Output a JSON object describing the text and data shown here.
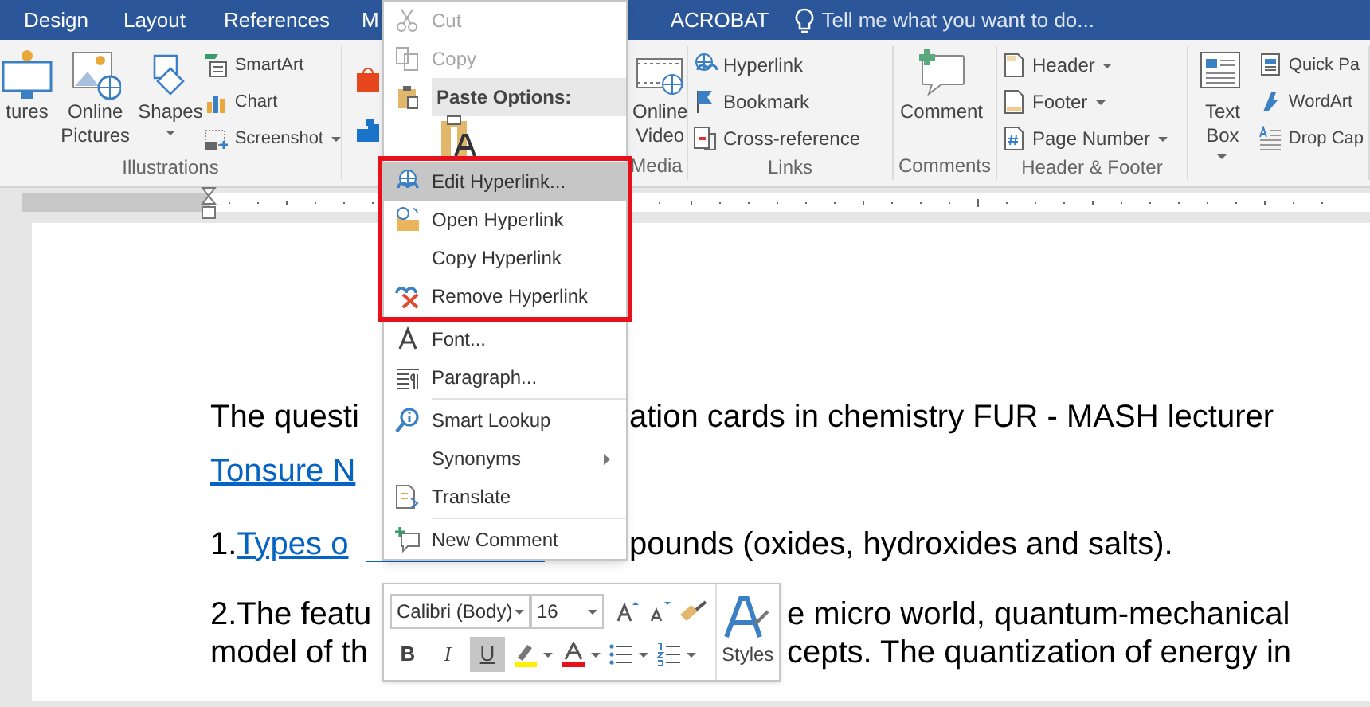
{
  "tabs": [
    {
      "label": "Design"
    },
    {
      "label": "Layout"
    },
    {
      "label": "References"
    },
    {
      "label": "M"
    },
    {
      "label": "ACROBAT"
    }
  ],
  "tell_me": {
    "placeholder": "Tell me what you want to do..."
  },
  "ribbon_groups": [
    {
      "kind": "group",
      "label": "Illustrations",
      "items": [
        {
          "kind": "large",
          "label": "tures"
        },
        {
          "kind": "large",
          "label": "Online Pictures"
        },
        {
          "kind": "large",
          "label": "Shapes",
          "dropdown": true
        },
        {
          "kind": "stack",
          "items": [
            {
              "label": "SmartArt"
            },
            {
              "label": "Chart"
            },
            {
              "label": "Screenshot",
              "dropdown": true
            }
          ]
        }
      ]
    },
    {
      "kind": "icon_group"
    },
    {
      "kind": "group",
      "label": "Media",
      "items": [
        {
          "kind": "large",
          "label": "Online Video"
        }
      ]
    },
    {
      "kind": "group",
      "label": "Links",
      "items": [
        {
          "kind": "stack",
          "items": [
            {
              "label": "Hyperlink"
            },
            {
              "label": "Bookmark"
            },
            {
              "label": "Cross-reference"
            }
          ]
        }
      ]
    },
    {
      "kind": "group",
      "label": "Comments",
      "items": [
        {
          "kind": "large",
          "label": "Comment"
        }
      ]
    },
    {
      "kind": "group",
      "label": "Header & Footer",
      "items": [
        {
          "kind": "stack",
          "items": [
            {
              "label": "Header",
              "dropdown": true
            },
            {
              "label": "Footer",
              "dropdown": true
            },
            {
              "label": "Page Number",
              "dropdown": true
            }
          ]
        }
      ]
    },
    {
      "kind": "group",
      "items": [
        {
          "kind": "large",
          "label": "Text Box",
          "dropdown": true
        },
        {
          "kind": "stack",
          "items": [
            {
              "label": "Quick Pa"
            },
            {
              "label": "WordArt"
            },
            {
              "label": "Drop Cap"
            }
          ]
        }
      ]
    }
  ],
  "document": {
    "lines": [
      {
        "left": [
          {
            "text": "The questi",
            "link": false
          }
        ],
        "right": [
          {
            "text": "ation cards in chemistry FUR - MASH lecturer",
            "link": false
          }
        ]
      },
      {
        "left": [
          {
            "text": "Tonsure N",
            "link": true
          }
        ]
      },
      {
        "left": [
          {
            "text": "1. ",
            "link": false
          },
          {
            "text": "Types o",
            "link": true
          }
        ],
        "right": [
          {
            "text": "pounds (oxides, hydroxides and salts).",
            "link": false
          }
        ]
      },
      {
        "left": [
          {
            "text": "2.The featu",
            "link": false
          }
        ],
        "right": [
          {
            "text": "e micro world, quantum-mechanical",
            "link": false
          }
        ]
      },
      {
        "left": [
          {
            "text": "model of th",
            "link": false
          }
        ],
        "right": [
          {
            "text": "cepts. The quantization of energy in",
            "link": false
          }
        ]
      }
    ]
  },
  "context_menu": {
    "sections": [
      {
        "outlined": false,
        "items": [
          {
            "kind": "item",
            "label": "Cut",
            "disabled": true,
            "selected": false
          },
          {
            "kind": "item",
            "label": "Copy",
            "disabled": true,
            "selected": false
          },
          {
            "kind": "header",
            "label": "Paste Options:"
          },
          {
            "kind": "paste_option"
          }
        ]
      },
      {
        "outlined": true,
        "items": [
          {
            "kind": "item",
            "label": "Edit Hyperlink...",
            "disabled": false,
            "selected": true
          },
          {
            "kind": "item",
            "label": "Open Hyperlink",
            "disabled": false,
            "selected": false
          },
          {
            "kind": "item",
            "label": "Copy Hyperlink",
            "disabled": false,
            "selected": false
          },
          {
            "kind": "item",
            "label": "Remove Hyperlink",
            "disabled": false,
            "selected": false
          }
        ]
      },
      {
        "outlined": false,
        "items": [
          {
            "kind": "item",
            "label": "Font...",
            "disabled": false,
            "selected": false
          },
          {
            "kind": "item",
            "label": "Paragraph...",
            "disabled": false,
            "selected": false
          }
        ]
      },
      {
        "outlined": false,
        "items": [
          {
            "kind": "item",
            "label": "Smart Lookup",
            "disabled": false,
            "selected": false
          },
          {
            "kind": "item",
            "label": "Synonyms",
            "disabled": false,
            "selected": false,
            "submenu": true
          },
          {
            "kind": "item",
            "label": "Translate",
            "disabled": false,
            "selected": false
          }
        ]
      },
      {
        "outlined": false,
        "items": [
          {
            "kind": "item",
            "label": "New Comment",
            "disabled": false,
            "selected": false
          }
        ]
      }
    ]
  },
  "mini_toolbar": {
    "font": "Calibri (Body)",
    "size": "16",
    "styles_label": "Styles",
    "format_buttons": [
      {
        "label": "B",
        "pressed": false
      },
      {
        "label": "I",
        "pressed": false
      },
      {
        "label": "U",
        "pressed": true
      }
    ]
  }
}
